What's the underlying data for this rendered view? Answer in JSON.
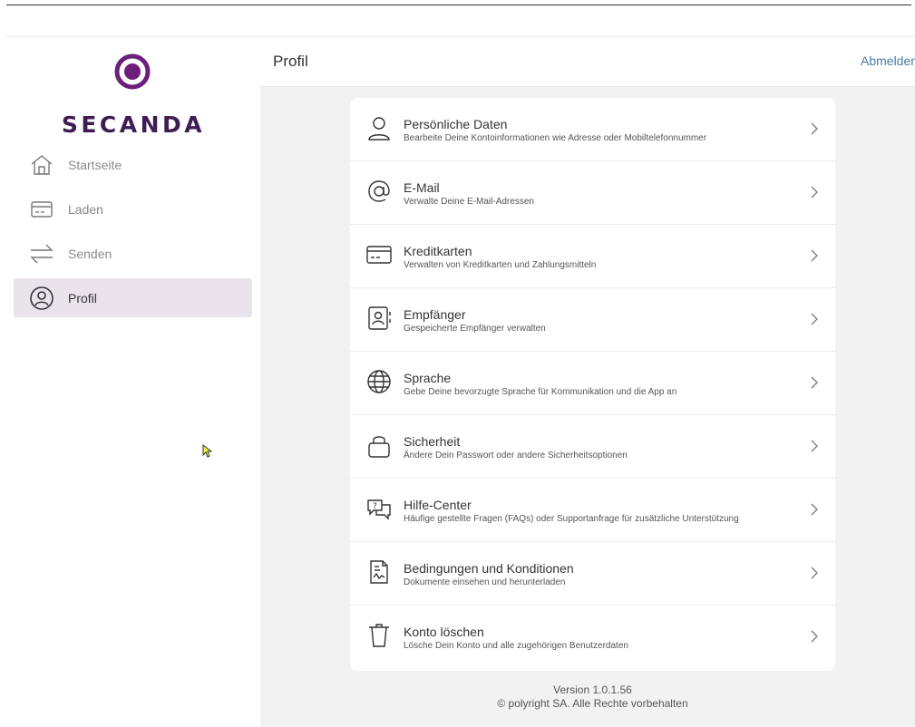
{
  "brand": {
    "name": "SECANDA",
    "color": "#3f1d52",
    "accent": "#6b1f7a"
  },
  "sidebar": {
    "items": [
      {
        "label": "Startseite",
        "icon": "home-icon",
        "active": false
      },
      {
        "label": "Laden",
        "icon": "card-icon",
        "active": false
      },
      {
        "label": "Senden",
        "icon": "transfer-arrows-icon",
        "active": false
      },
      {
        "label": "Profil",
        "icon": "user-circle-icon",
        "active": true
      }
    ]
  },
  "header": {
    "title": "Profil",
    "logout_label": "Abmelden"
  },
  "settings": {
    "rows": [
      {
        "title": "Persönliche Daten",
        "subtitle": "Bearbeite Deine Kontoinformationen wie Adresse oder Mobiltelefonnummer",
        "icon": "person-icon"
      },
      {
        "title": "E-Mail",
        "subtitle": "Verwalte Deine E-Mail-Adressen",
        "icon": "at-icon"
      },
      {
        "title": "Kreditkarten",
        "subtitle": "Verwalten von Kreditkarten und Zahlungsmitteln",
        "icon": "credit-card-icon"
      },
      {
        "title": "Empfänger",
        "subtitle": "Gespeicherte Empfänger verwalten",
        "icon": "contact-book-icon"
      },
      {
        "title": "Sprache",
        "subtitle": "Gebe Deine bevorzugte Sprache für Kommunikation und die App an",
        "icon": "globe-icon"
      },
      {
        "title": "Sicherheit",
        "subtitle": "Ändere Dein Passwort oder andere Sicherheitsoptionen",
        "icon": "lock-icon"
      },
      {
        "title": "Hilfe-Center",
        "subtitle": "Häufige gestellte Fragen (FAQs) oder Supportanfrage für zusätzliche Unterstützung",
        "icon": "help-chat-icon"
      },
      {
        "title": "Bedingungen und Konditionen",
        "subtitle": "Dokumente einsehen und herunterladen",
        "icon": "document-icon"
      },
      {
        "title": "Konto löschen",
        "subtitle": "Lösche Dein Konto und alle zugehörigen Benutzerdaten",
        "icon": "trash-icon"
      }
    ]
  },
  "footer": {
    "version": "Version 1.0.1.56",
    "copyright": "© polyright SA. Alle Rechte vorbehalten"
  }
}
